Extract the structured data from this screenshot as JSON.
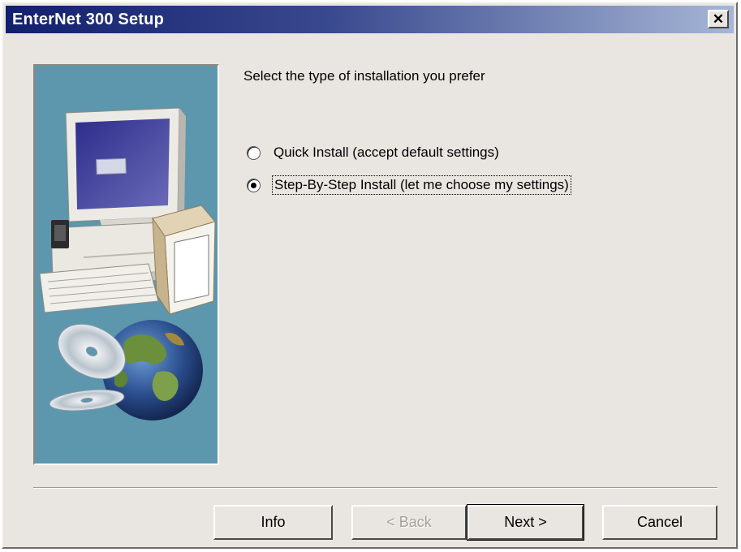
{
  "window": {
    "title": "EnterNet 300 Setup",
    "close_glyph": "✕"
  },
  "content": {
    "prompt": "Select the type of installation you prefer",
    "options": [
      {
        "label": "Quick Install (accept default settings)",
        "selected": false
      },
      {
        "label": "Step-By-Step Install (let me choose my settings)",
        "selected": true
      }
    ]
  },
  "buttons": {
    "info": "Info",
    "back": "< Back",
    "next": "Next >",
    "cancel": "Cancel"
  },
  "icons": {
    "illustration": "computer-cd-globe-illustration",
    "close": "close-icon"
  },
  "colors": {
    "titlebar_start": "#121f6d",
    "titlebar_end": "#a6b6d6",
    "dialog_bg": "#e9e6e1",
    "art_bg": "#5c97ae"
  }
}
